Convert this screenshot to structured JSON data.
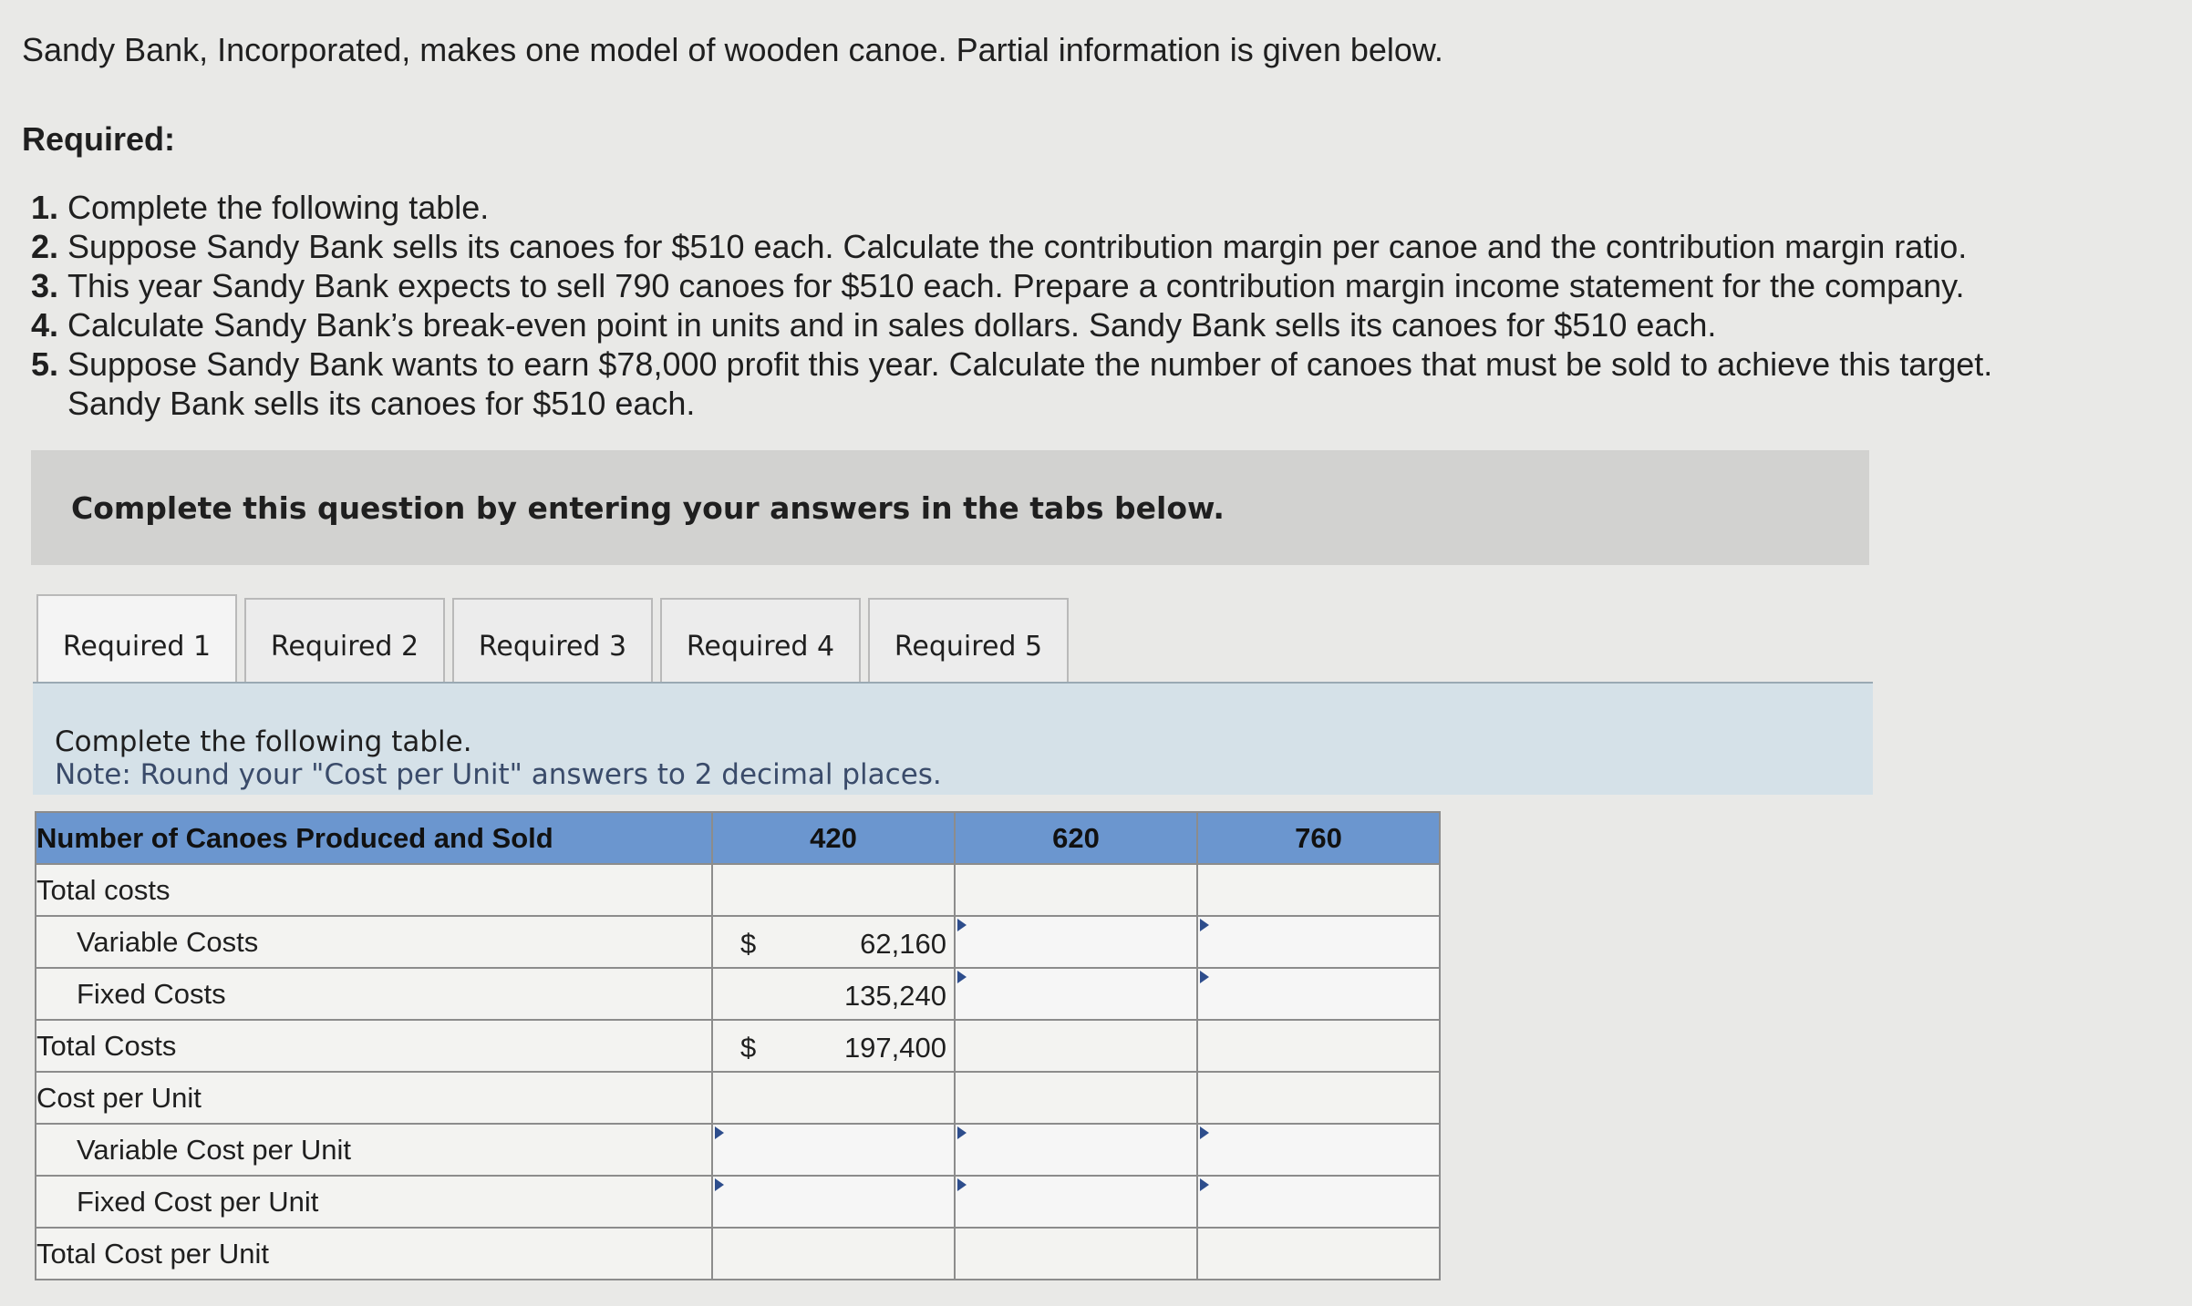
{
  "intro": "Sandy Bank, Incorporated, makes one model of wooden canoe. Partial information is given below.",
  "required_heading": "Required:",
  "requirements": [
    {
      "num": "1.",
      "text": "Complete the following table."
    },
    {
      "num": "2.",
      "text": "Suppose Sandy Bank sells its canoes for $510 each. Calculate the contribution margin per canoe and the contribution margin ratio."
    },
    {
      "num": "3.",
      "text": "This year Sandy Bank expects to sell 790 canoes for $510 each. Prepare a contribution margin income statement for the company."
    },
    {
      "num": "4.",
      "text": "Calculate Sandy Bank’s break-even point in units and in sales dollars. Sandy Bank sells its canoes for $510 each."
    },
    {
      "num": "5.",
      "text": "Suppose Sandy Bank wants to earn $78,000 profit this year. Calculate the number of canoes that must be sold to achieve this target. Sandy Bank sells its canoes for $510 each."
    }
  ],
  "banner": "Complete this question by entering your answers in the tabs below.",
  "tabs": [
    "Required 1",
    "Required 2",
    "Required 3",
    "Required 4",
    "Required 5"
  ],
  "active_tab": "Required 1",
  "panel": {
    "line1": "Complete the following table.",
    "line2": "Note: Round your \"Cost per Unit\" answers to 2 decimal places."
  },
  "table": {
    "header": [
      "Number of Canoes Produced and Sold",
      "420",
      "620",
      "760"
    ],
    "labels": {
      "total_costs_section": "Total costs",
      "variable_costs": "Variable Costs",
      "fixed_costs": "Fixed Costs",
      "total_costs": "Total Costs",
      "cost_per_unit_section": "Cost per Unit",
      "variable_cost_per_unit": "Variable Cost per Unit",
      "fixed_cost_per_unit": "Fixed Cost per Unit",
      "total_cost_per_unit": "Total Cost per Unit"
    },
    "currency": "$",
    "values_420": {
      "variable_costs": "62,160",
      "fixed_costs": "135,240",
      "total_costs": "197,400"
    }
  }
}
